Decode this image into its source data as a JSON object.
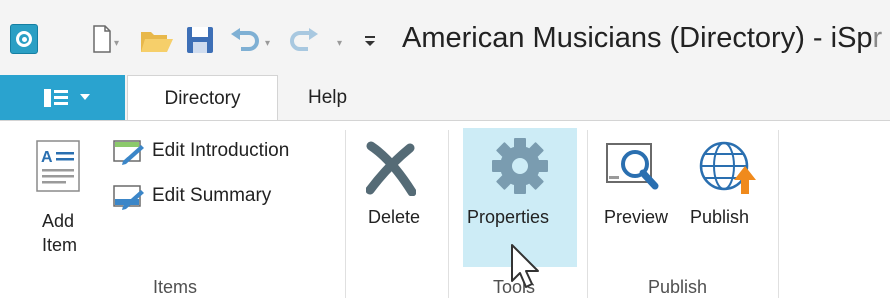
{
  "window": {
    "title": "American Musicians (Directory) - iSpr",
    "title_main": "American Musicians (Directory) - iSp",
    "title_fade": "r"
  },
  "quick_access": {
    "icons": [
      "new-document-icon",
      "open-folder-icon",
      "save-icon",
      "undo-icon",
      "redo-icon",
      "customize-toolbar-icon"
    ]
  },
  "tabs": {
    "file_menu_icon": "list-icon",
    "items": [
      {
        "label": "Directory",
        "active": true
      },
      {
        "label": "Help",
        "active": false
      }
    ]
  },
  "ribbon": {
    "groups": [
      {
        "label": "Items",
        "add_item_label": "Add\nItem",
        "add_item_line1": "Add",
        "add_item_line2": "Item",
        "edit_introduction_label": "Edit Introduction",
        "edit_summary_label": "Edit Summary"
      },
      {
        "label": "",
        "delete_label": "Delete"
      },
      {
        "label": "Tools",
        "properties_label": "Properties"
      },
      {
        "label": "Publish",
        "preview_label": "Preview",
        "publish_label": "Publish"
      }
    ]
  },
  "colors": {
    "accent": "#2aa3cf",
    "hover_highlight": "#cdecf6",
    "gear": "#7a9cb0",
    "delete_x": "#556b76",
    "publish_arrow": "#f08a1c"
  }
}
